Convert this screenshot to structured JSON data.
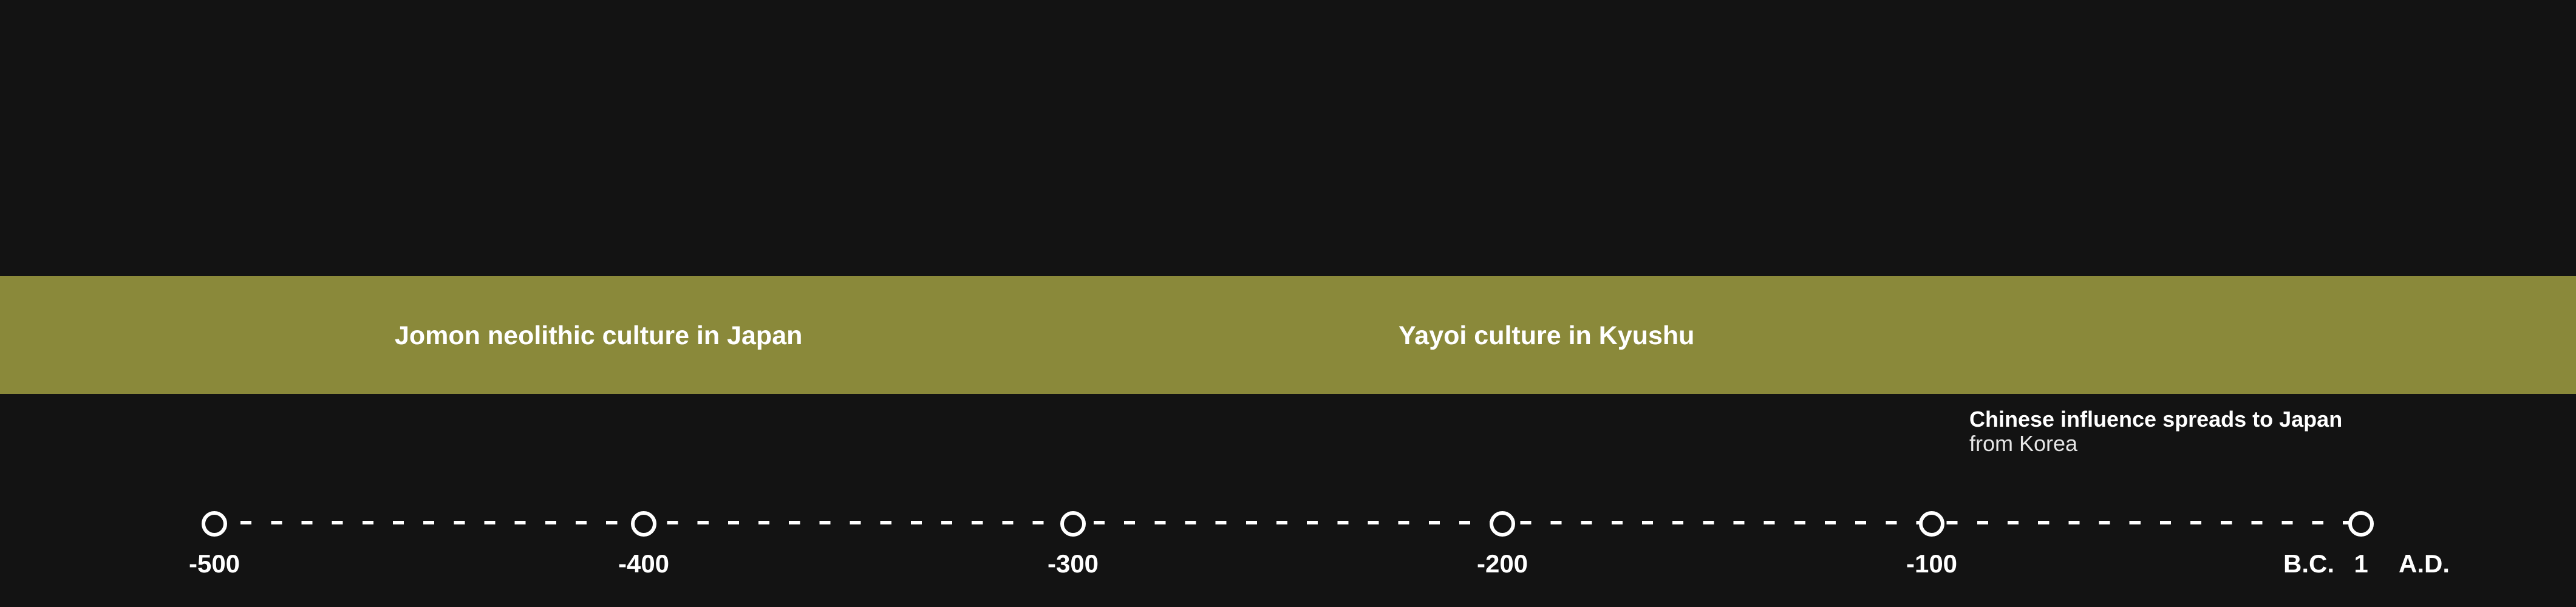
{
  "eras": [
    {
      "label": "Jomon neolithic culture in Japan"
    },
    {
      "label": "Yayoi culture in Kyushu"
    }
  ],
  "event": {
    "title": "Chinese influence spreads to Japan",
    "subtitle": "from Korea"
  },
  "axis": {
    "ticks": [
      "-500",
      "-400",
      "-300",
      "-200",
      "-100",
      "1"
    ],
    "bc_label": "B.C.",
    "ad_label": "A.D."
  },
  "colors": {
    "background": "#131313",
    "era_band": "#8a893a",
    "text": "#ffffff"
  }
}
